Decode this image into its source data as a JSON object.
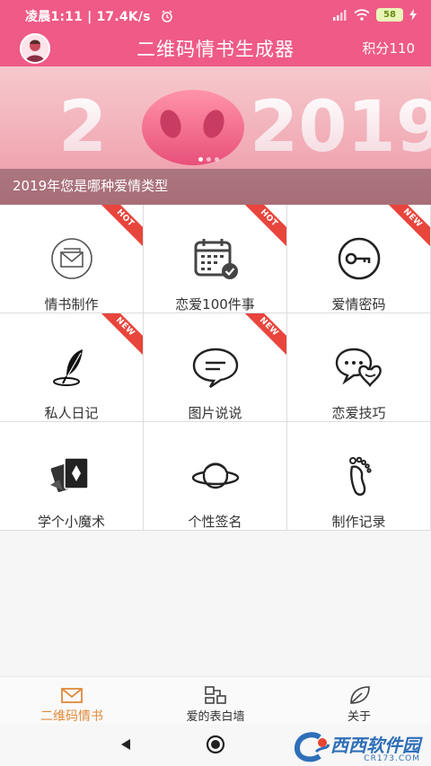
{
  "status_bar": {
    "time_text": "凌晨1:11 | 17.4K/s",
    "battery": "58"
  },
  "header": {
    "title": "二维码情书生成器",
    "score": "积分110"
  },
  "banner": {
    "year_text": "2019",
    "caption": "2019年您是哪种爱情类型",
    "slide_count": 3,
    "active_slide": 1
  },
  "grid": {
    "items": [
      {
        "label": "情书制作",
        "icon": "envelope-icon",
        "badge": "HOT"
      },
      {
        "label": "恋爱100件事",
        "icon": "calendar-check-icon",
        "badge": "HOT"
      },
      {
        "label": "爱情密码",
        "icon": "key-icon",
        "badge": "NEW"
      },
      {
        "label": "私人日记",
        "icon": "quill-icon",
        "badge": "NEW"
      },
      {
        "label": "图片说说",
        "icon": "chat-bubble-icon",
        "badge": "NEW"
      },
      {
        "label": "恋爱技巧",
        "icon": "love-chat-icon",
        "badge": ""
      },
      {
        "label": "学个小魔术",
        "icon": "cards-icon",
        "badge": ""
      },
      {
        "label": "个性签名",
        "icon": "planet-icon",
        "badge": ""
      },
      {
        "label": "制作记录",
        "icon": "footprint-icon",
        "badge": ""
      }
    ]
  },
  "bottom_nav": {
    "tabs": [
      {
        "label": "二维码情书",
        "icon": "mail-icon",
        "active": true
      },
      {
        "label": "爱的表白墙",
        "icon": "wall-icon",
        "active": false
      },
      {
        "label": "关于",
        "icon": "leaf-icon",
        "active": false
      }
    ]
  },
  "watermark": {
    "text": "西西软件园",
    "sub": "CR173.COM"
  },
  "colors": {
    "brand": "#ef5a87",
    "active_tab": "#e08a3a",
    "ribbon": "#e8453c"
  }
}
